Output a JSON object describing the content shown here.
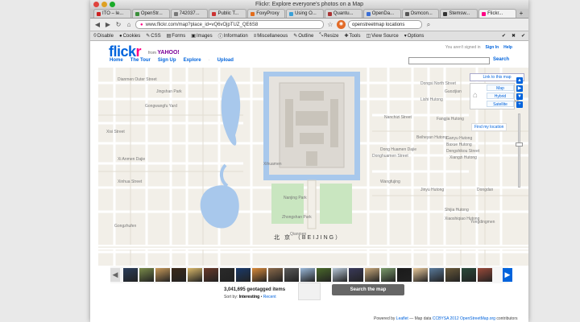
{
  "browser": {
    "window_title": "Flickr: Explore everyone's photos on a Map",
    "tabs": [
      {
        "label": "ITO – le...",
        "color": "#cc2222",
        "active": false
      },
      {
        "label": "OpenStr...",
        "color": "#3b8f3b",
        "active": false
      },
      {
        "label": "742037...",
        "color": "#777777",
        "active": false
      },
      {
        "label": "Public T...",
        "color": "#cc3333",
        "active": false
      },
      {
        "label": "FoxyProxy",
        "color": "#e36c1b",
        "active": false
      },
      {
        "label": "Using O...",
        "color": "#3aa0d8",
        "active": false
      },
      {
        "label": "Quantu...",
        "color": "#aa3333",
        "active": false
      },
      {
        "label": "OpenDa...",
        "color": "#3b6fd6",
        "active": false
      },
      {
        "label": "Osmcon...",
        "color": "#555555",
        "active": false
      },
      {
        "label": "Stemsw...",
        "color": "#333333",
        "active": false
      },
      {
        "label": "Flickr...",
        "color": "#ff0084",
        "active": true
      }
    ],
    "url": "www.flickr.com/map?place_id=vQ6vOjpTUZ_QE6S8",
    "search_value": "openstreetmap locations",
    "toolbar": [
      "Disable",
      "Cookies",
      "CSS",
      "Forms",
      "Images",
      "Information",
      "Miscellaneous",
      "Outline",
      "Resize",
      "Tools",
      "View Source",
      "Options"
    ]
  },
  "header": {
    "logo_text": "flickr",
    "from_text": "from",
    "yahoo_text": "YAHOO!",
    "nav": [
      "Home",
      "The Tour",
      "Sign Up",
      "Explore",
      "Upload"
    ],
    "not_signed_in": "You aren't signed in",
    "sign_in": "Sign In",
    "help": "Help",
    "search_button": "Search"
  },
  "map": {
    "link_to_map": "Link to this map",
    "modes": [
      "Map",
      "Hybrid",
      "Satellite"
    ],
    "find_location": "Find my location",
    "city_label": "北 京 （BEIJING）",
    "labels": [
      "Dianmen Outer Street",
      "Jingshan Park",
      "Donghuamen Street",
      "Dong Huamen Dajie",
      "Gongwangfu Yard",
      "Xisi Street",
      "Yongdingmen",
      "Beiheyan Hutong",
      "Dongsi North Street",
      "Guozijian",
      "Nanchizi Street",
      "Zhongshan Park",
      "Xihuamen",
      "Xi Anmen Dajie",
      "Qianmen",
      "Ganyu Hutong",
      "Baxue Hutong",
      "Dengshikou Street",
      "Xiangzi Hutong",
      "Fangjia Hutong",
      "Dongdan",
      "Nanjing Park",
      "Xinhua Street",
      "Wangfujing",
      "Jinyu Hutong",
      "Shijia Hutong",
      "Chaoyangmen",
      "Gongzhufen",
      "Xiaoshiqiao Hutong",
      "Lishi Hutong"
    ]
  },
  "photos": {
    "count_text": "3,041,695 geotagged items",
    "sort_prefix": "Sort by:",
    "sort_interesting": "Interesting",
    "sort_sep": "•",
    "sort_recent": "Recent",
    "search_map_button": "Search the map",
    "thumbs": [
      "#2b3d5a",
      "#7a8b4a",
      "#c89a5a",
      "#3b2a1a",
      "#d9b86a",
      "#6a3a2a",
      "#2a2a2a",
      "#1a3a6a",
      "#d98a3a",
      "#8a6a4a",
      "#5a5a5a",
      "#9ab8d8",
      "#4a6a2a",
      "#b8c8d8",
      "#3a3a5a",
      "#c8a87a",
      "#7a9a6a",
      "#1a1a1a",
      "#e8c89a",
      "#5a7a9a",
      "#6a5a3a",
      "#2a4a3a",
      "#9a4a3a"
    ]
  },
  "attribution": {
    "powered_by": "Powered by",
    "leaflet": "Leaflet",
    "map_data": "— Map data",
    "license": "CCBYSA 2012",
    "osm": "OpenStreetMap.org",
    "contributors": "contributors"
  }
}
